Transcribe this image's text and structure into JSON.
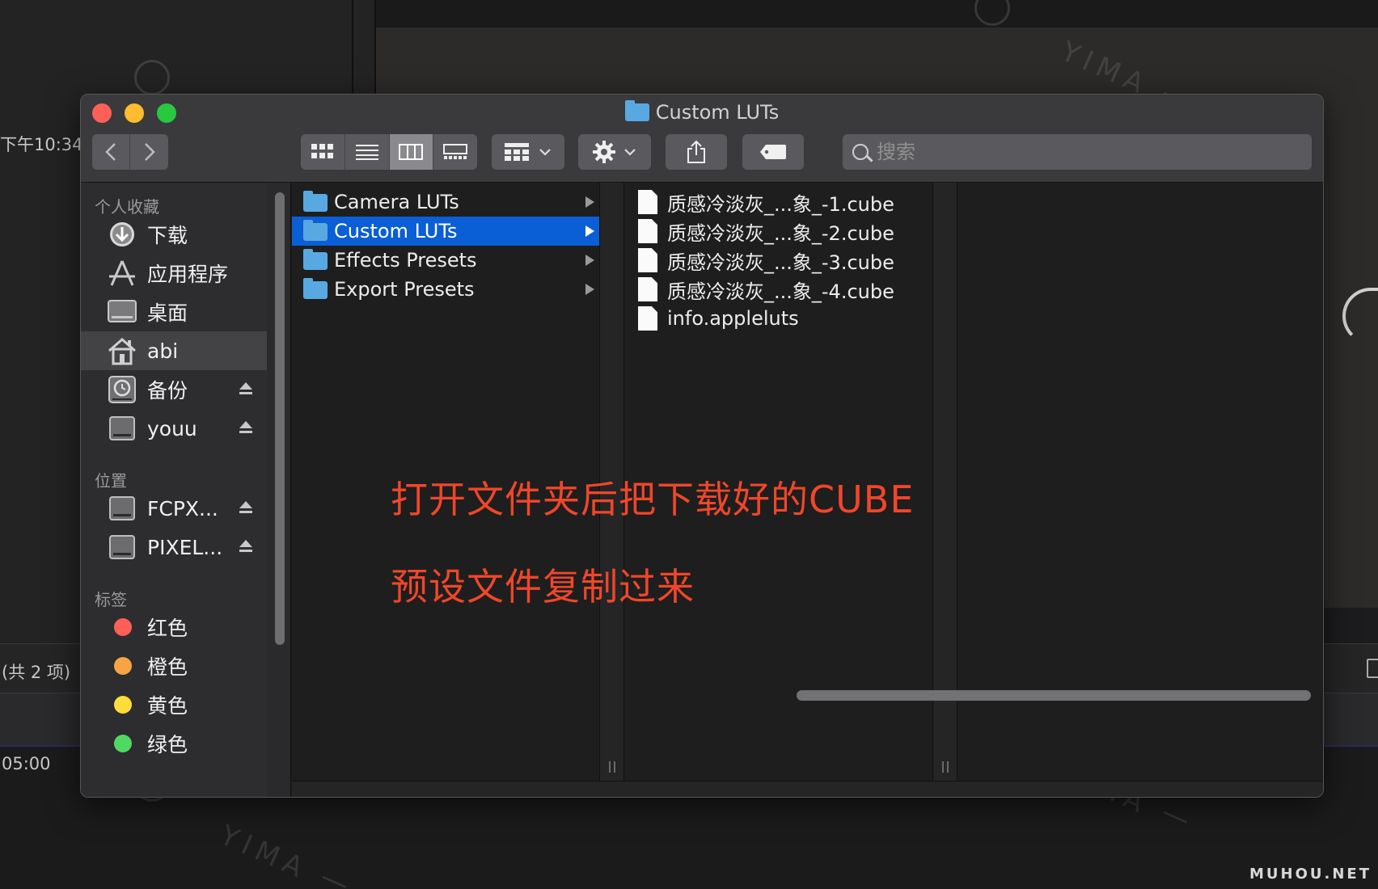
{
  "background": {
    "time_text": "下午10:34",
    "count_text": "(共 2 项)",
    "timecode": "05:00"
  },
  "watermark": {
    "text": "YIMA 一 ",
    "footer": "MUHOU.NET"
  },
  "window": {
    "title": "Custom LUTs",
    "search_placeholder": "搜索"
  },
  "sidebar": {
    "favorites_header": "个人收藏",
    "favorites": [
      {
        "label": "下载",
        "icon": "download-icon"
      },
      {
        "label": "应用程序",
        "icon": "applications-icon"
      },
      {
        "label": "桌面",
        "icon": "desktop-icon"
      },
      {
        "label": "abi",
        "icon": "home-icon",
        "selected": true
      },
      {
        "label": "备份",
        "icon": "time-machine-icon",
        "eject": true
      },
      {
        "label": "youu",
        "icon": "disk-icon",
        "eject": true
      }
    ],
    "locations_header": "位置",
    "locations": [
      {
        "label": "FCPX...",
        "icon": "disk-icon",
        "eject": true
      },
      {
        "label": "PIXEL...",
        "icon": "disk-icon",
        "eject": true
      }
    ],
    "tags_header": "标签",
    "tags": [
      {
        "label": "红色",
        "color": "#fe5f57"
      },
      {
        "label": "橙色",
        "color": "#f7a446"
      },
      {
        "label": "黄色",
        "color": "#fddc3c"
      },
      {
        "label": "绿色",
        "color": "#4fd963"
      }
    ]
  },
  "columns": {
    "col1": [
      {
        "label": "Camera LUTs",
        "selected": false
      },
      {
        "label": "Custom LUTs",
        "selected": true
      },
      {
        "label": "Effects Presets",
        "selected": false
      },
      {
        "label": "Export Presets",
        "selected": false
      }
    ],
    "col2": [
      {
        "label": "质感冷淡灰_...象_-1.cube"
      },
      {
        "label": "质感冷淡灰_...象_-2.cube"
      },
      {
        "label": "质感冷淡灰_...象_-3.cube"
      },
      {
        "label": "质感冷淡灰_...象_-4.cube"
      },
      {
        "label": "info.appleluts"
      }
    ]
  },
  "annotation": {
    "line1": "打开文件夹后把下载好的CUBE",
    "line2": "预设文件复制过来"
  }
}
